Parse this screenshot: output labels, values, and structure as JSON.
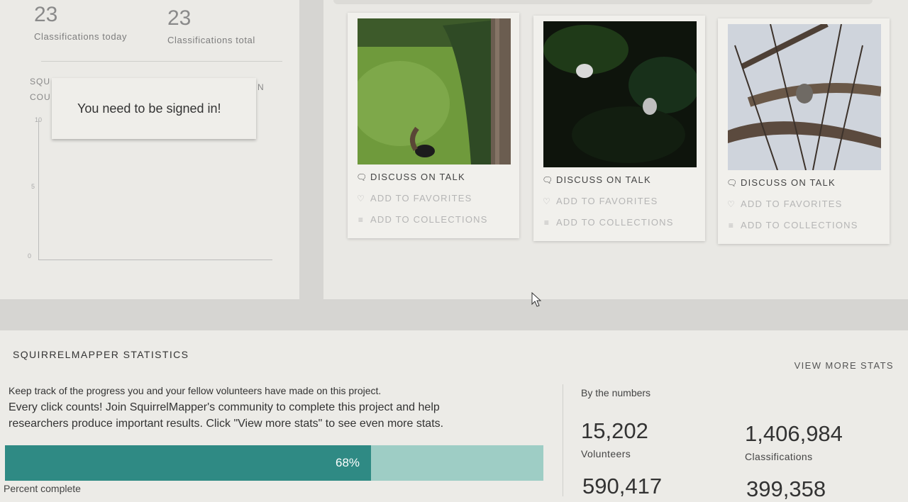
{
  "user_stats": {
    "today_count": "23",
    "today_label": "Classifications today",
    "total_count": "23",
    "total_label": "Classifications total"
  },
  "chart": {
    "title_partial_1": "SQU",
    "title_partial_2": "COU",
    "title_partial_right": "N",
    "y_ticks": [
      "10",
      "5",
      "0"
    ]
  },
  "toast": {
    "message": "You need to be signed in!"
  },
  "cards": [
    {
      "photo": "squirrel-on-lawn",
      "discuss": "DISCUSS ON TALK",
      "favorite": "ADD TO FAVORITES",
      "collect": "ADD TO COLLECTIONS"
    },
    {
      "photo": "dark-foliage",
      "discuss": "DISCUSS ON TALK",
      "favorite": "ADD TO FAVORITES",
      "collect": "ADD TO COLLECTIONS"
    },
    {
      "photo": "squirrel-in-tree",
      "discuss": "DISCUSS ON TALK",
      "favorite": "ADD TO FAVORITES",
      "collect": "ADD TO COLLECTIONS"
    }
  ],
  "project_stats": {
    "title": "SQUIRRELMAPPER STATISTICS",
    "view_more": "VIEW MORE STATS",
    "line1": "Keep track of the progress you and your fellow volunteers have made on this project.",
    "line2": "Every click counts! Join SquirrelMapper's community to complete this project and help",
    "line3": "researchers produce important results. Click \"View more stats\" to see even more stats.",
    "progress_fraction": 0.68,
    "progress_text": "68%",
    "progress_label": "Percent complete",
    "colors": {
      "fill": "#2f8a84",
      "track": "#9ecdc5"
    }
  },
  "by_numbers": {
    "heading": "By the numbers",
    "volunteers_value": "15,202",
    "volunteers_label": "Volunteers",
    "classifications_value": "1,406,984",
    "classifications_label": "Classifications",
    "third_value": "590,417",
    "fourth_value": "399,358"
  }
}
